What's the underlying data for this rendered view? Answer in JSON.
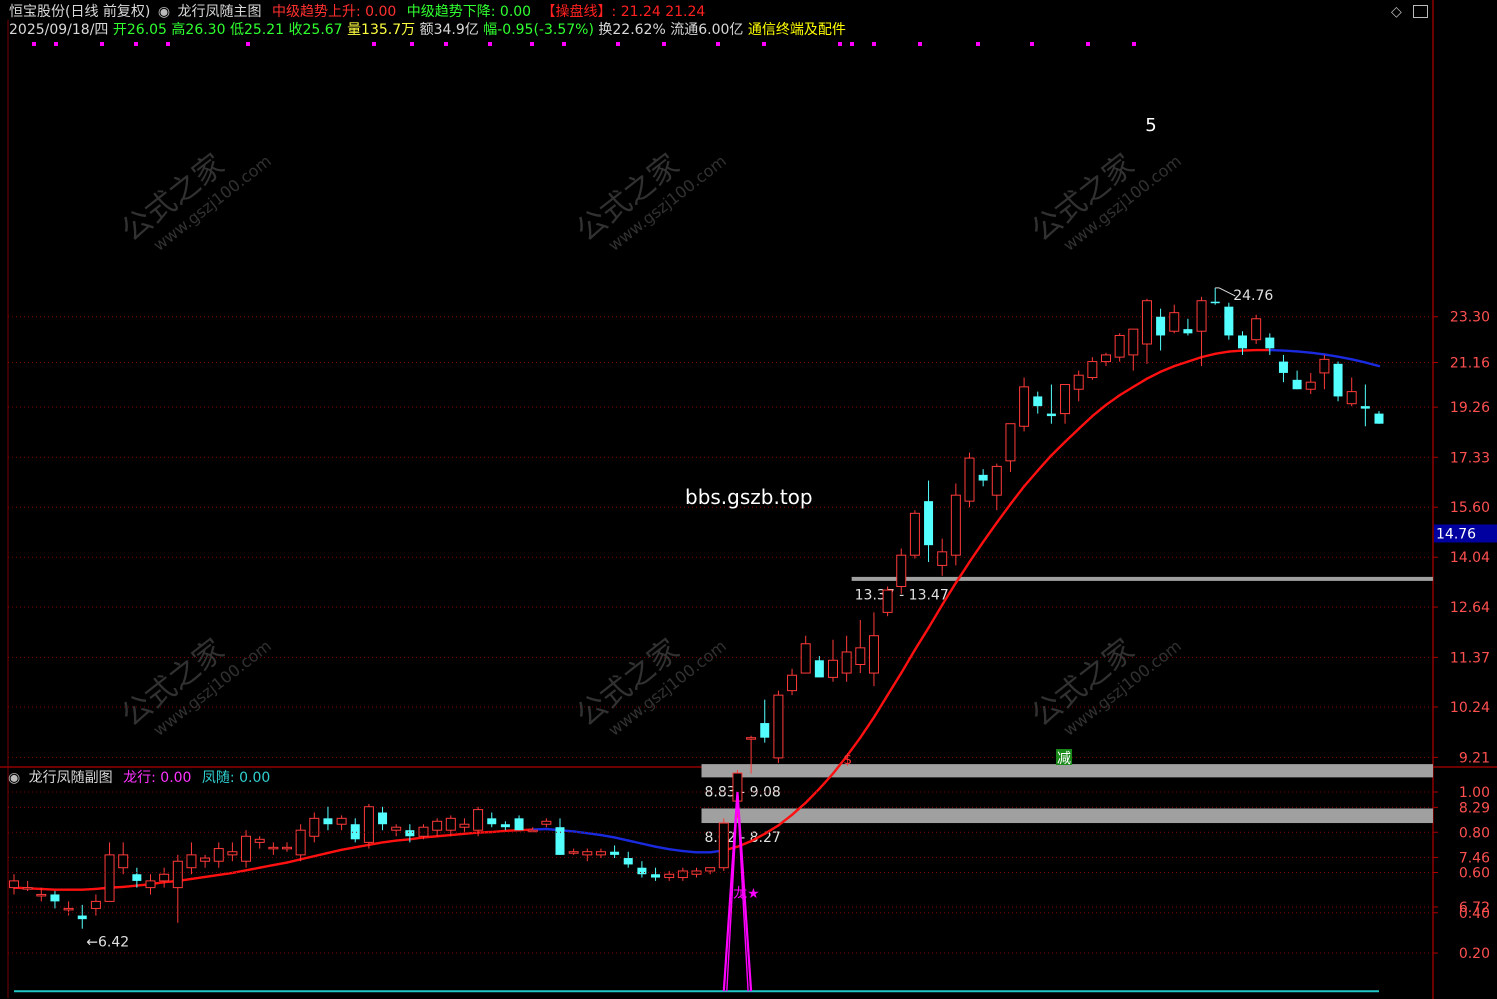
{
  "header": {
    "stock_name": "恒宝股份(日线 前复权)",
    "main_title": "龙行凤随主图",
    "mid_up": "中级趋势上升: 0.00",
    "mid_down": "中级趋势下降: 0.00",
    "control_line": "【操盘线】: 21.24 21.24"
  },
  "quote": {
    "date": "2025/09/18/四",
    "open": "开26.05",
    "high": "高26.30",
    "low": "低25.21",
    "close": "收25.67",
    "volume": "量135.7万",
    "amount": "额34.9亿",
    "change": "幅-0.95(-3.57%)",
    "turnover": "换22.62%",
    "float": "流通6.00亿",
    "link": "通信终端及配件"
  },
  "watermark": {
    "cn": "公式之家",
    "url": "www.gszj100.com",
    "site": "bbs.gszb.top"
  },
  "sub_header": {
    "title": "龙行凤随副图",
    "dragon": "龙行: 0.00",
    "phoenix": "凤随: 0.00"
  },
  "colors": {
    "up": "#ff3a3a",
    "down": "#54ffff",
    "ma_red": "#ff1010",
    "ma_blue": "#1a2adf",
    "grid": "#7a0000",
    "axis_text": "#ff5050",
    "magenta": "#ff00ff",
    "zone": "#a0a0a0"
  },
  "chart_data": [
    {
      "type": "candlestick",
      "axis_ticks": [
        "23.30",
        "21.16",
        "19.26",
        "17.33",
        "15.60",
        "14.04",
        "12.64",
        "11.37",
        "10.24",
        "9.21",
        "8.29",
        "7.46",
        "6.72"
      ],
      "ylim": [
        6.2,
        25.7
      ],
      "current_price_label": "14.76",
      "annotations": {
        "high_label": "24.76",
        "low_label": "6.42",
        "s_marker": "$",
        "jian_marker": "减",
        "digit_marker": "5"
      },
      "zones": [
        {
          "label": "13.37 - 13.47",
          "low": 13.37,
          "high": 13.47
        },
        {
          "label": "8.83 - 9.08",
          "low": 8.83,
          "high": 9.08
        },
        {
          "label": "8.02 - 8.27",
          "low": 8.02,
          "high": 8.27
        }
      ],
      "candles": [
        [
          7.0,
          7.2,
          6.9,
          7.1
        ],
        [
          7.0,
          7.1,
          6.95,
          7.0
        ],
        [
          6.9,
          7.0,
          6.8,
          6.9
        ],
        [
          6.9,
          6.95,
          6.7,
          6.8
        ],
        [
          6.7,
          6.8,
          6.6,
          6.7
        ],
        [
          6.6,
          6.75,
          6.42,
          6.55
        ],
        [
          6.7,
          6.9,
          6.6,
          6.8
        ],
        [
          6.8,
          7.7,
          6.8,
          7.5
        ],
        [
          7.3,
          7.7,
          7.2,
          7.5
        ],
        [
          7.2,
          7.3,
          7.0,
          7.1
        ],
        [
          7.0,
          7.2,
          6.9,
          7.1
        ],
        [
          7.1,
          7.3,
          7.0,
          7.2
        ],
        [
          7.0,
          7.5,
          6.5,
          7.4
        ],
        [
          7.3,
          7.7,
          7.2,
          7.5
        ],
        [
          7.4,
          7.5,
          7.3,
          7.45
        ],
        [
          7.4,
          7.7,
          7.3,
          7.6
        ],
        [
          7.5,
          7.7,
          7.4,
          7.55
        ],
        [
          7.4,
          7.9,
          7.3,
          7.8
        ],
        [
          7.7,
          7.8,
          7.6,
          7.75
        ],
        [
          7.6,
          7.7,
          7.5,
          7.62
        ],
        [
          7.6,
          7.7,
          7.55,
          7.62
        ],
        [
          7.5,
          8.0,
          7.4,
          7.9
        ],
        [
          7.8,
          8.2,
          7.7,
          8.1
        ],
        [
          8.1,
          8.3,
          7.9,
          8.0
        ],
        [
          8.0,
          8.15,
          7.9,
          8.1
        ],
        [
          8.0,
          8.1,
          7.7,
          7.75
        ],
        [
          7.7,
          8.35,
          7.6,
          8.3
        ],
        [
          8.2,
          8.3,
          7.9,
          8.0
        ],
        [
          7.9,
          8.0,
          7.8,
          7.95
        ],
        [
          7.9,
          8.0,
          7.7,
          7.8
        ],
        [
          7.8,
          8.0,
          7.75,
          7.95
        ],
        [
          7.9,
          8.1,
          7.8,
          8.05
        ],
        [
          7.9,
          8.15,
          7.8,
          8.1
        ],
        [
          7.95,
          8.1,
          7.85,
          8.0
        ],
        [
          7.9,
          8.3,
          7.8,
          8.25
        ],
        [
          8.1,
          8.2,
          7.95,
          8.0
        ],
        [
          8.0,
          8.05,
          7.9,
          7.95
        ],
        [
          8.1,
          8.15,
          7.9,
          7.9
        ],
        [
          7.9,
          7.95,
          7.9,
          7.9
        ],
        [
          8.0,
          8.1,
          7.95,
          8.05
        ],
        [
          7.95,
          8.1,
          7.5,
          7.5
        ],
        [
          7.55,
          7.6,
          7.5,
          7.55
        ],
        [
          7.5,
          7.6,
          7.4,
          7.55
        ],
        [
          7.5,
          7.6,
          7.45,
          7.55
        ],
        [
          7.55,
          7.65,
          7.45,
          7.5
        ],
        [
          7.45,
          7.55,
          7.3,
          7.35
        ],
        [
          7.3,
          7.4,
          7.15,
          7.2
        ],
        [
          7.2,
          7.3,
          7.1,
          7.15
        ],
        [
          7.15,
          7.25,
          7.1,
          7.2
        ],
        [
          7.15,
          7.3,
          7.1,
          7.25
        ],
        [
          7.2,
          7.3,
          7.15,
          7.25
        ],
        [
          7.25,
          7.3,
          7.2,
          7.3
        ],
        [
          7.3,
          8.1,
          7.25,
          8.02
        ],
        [
          8.4,
          8.97,
          8.1,
          8.91
        ],
        [
          9.6,
          9.64,
          8.9,
          9.6
        ],
        [
          9.9,
          10.4,
          9.5,
          9.6
        ],
        [
          9.2,
          10.6,
          9.1,
          10.5
        ],
        [
          10.6,
          11.1,
          10.5,
          10.95
        ],
        [
          11.0,
          11.9,
          11.0,
          11.7
        ],
        [
          11.3,
          11.4,
          10.9,
          10.9
        ],
        [
          10.9,
          11.8,
          10.8,
          11.3
        ],
        [
          11.0,
          11.9,
          10.8,
          11.5
        ],
        [
          11.2,
          12.3,
          11.0,
          11.6
        ],
        [
          11.0,
          12.5,
          10.7,
          11.9
        ],
        [
          12.5,
          13.2,
          12.4,
          13.1
        ],
        [
          13.2,
          14.3,
          13.0,
          14.1
        ],
        [
          14.1,
          15.5,
          14.0,
          15.4
        ],
        [
          15.8,
          16.5,
          13.9,
          14.4
        ],
        [
          13.8,
          14.6,
          13.5,
          14.2
        ],
        [
          14.1,
          16.4,
          13.8,
          16.0
        ],
        [
          15.8,
          17.5,
          15.6,
          17.3
        ],
        [
          16.7,
          16.9,
          16.3,
          16.5
        ],
        [
          16.0,
          17.1,
          15.5,
          17.0
        ],
        [
          17.2,
          18.6,
          16.8,
          18.6
        ],
        [
          18.5,
          20.5,
          18.3,
          20.1
        ],
        [
          19.7,
          19.9,
          19.0,
          19.3
        ],
        [
          19.0,
          20.2,
          18.6,
          18.9
        ],
        [
          19.0,
          20.2,
          18.6,
          20.2
        ],
        [
          20.0,
          20.8,
          19.5,
          20.6
        ],
        [
          20.5,
          21.4,
          20.4,
          21.2
        ],
        [
          21.2,
          21.6,
          21.0,
          21.5
        ],
        [
          21.4,
          22.5,
          21.2,
          22.4
        ],
        [
          21.5,
          22.7,
          20.8,
          22.7
        ],
        [
          22.0,
          24.2,
          21.1,
          24.1
        ],
        [
          23.3,
          23.7,
          21.7,
          22.4
        ],
        [
          22.6,
          23.9,
          22.5,
          23.5
        ],
        [
          22.7,
          23.2,
          22.4,
          22.5
        ],
        [
          22.6,
          24.3,
          21.0,
          24.1
        ],
        [
          24.05,
          24.76,
          23.9,
          24.0
        ],
        [
          23.8,
          24.0,
          22.2,
          22.4
        ],
        [
          22.4,
          22.6,
          21.5,
          21.8
        ],
        [
          22.2,
          23.4,
          22.0,
          23.2
        ],
        [
          22.3,
          22.5,
          21.5,
          21.8
        ],
        [
          21.2,
          21.5,
          20.3,
          20.7
        ],
        [
          20.4,
          20.8,
          20.0,
          20.0
        ],
        [
          20.0,
          20.7,
          19.8,
          20.3
        ],
        [
          20.7,
          21.5,
          20.0,
          21.3
        ],
        [
          21.1,
          21.2,
          19.5,
          19.7
        ],
        [
          19.4,
          20.5,
          19.3,
          19.9
        ],
        [
          19.3,
          20.2,
          18.5,
          19.2
        ],
        [
          19.0,
          19.1,
          18.6,
          18.6
        ]
      ],
      "ma_values": [
        7.0,
        6.99,
        6.98,
        6.97,
        6.97,
        6.97,
        6.98,
        7.0,
        7.01,
        7.03,
        7.05,
        7.08,
        7.1,
        7.13,
        7.16,
        7.19,
        7.22,
        7.26,
        7.3,
        7.34,
        7.38,
        7.43,
        7.48,
        7.53,
        7.58,
        7.62,
        7.66,
        7.7,
        7.73,
        7.75,
        7.78,
        7.8,
        7.82,
        7.84,
        7.86,
        7.87,
        7.89,
        7.9,
        7.91,
        7.92,
        7.9,
        7.88,
        7.85,
        7.82,
        7.78,
        7.73,
        7.68,
        7.63,
        7.59,
        7.56,
        7.54,
        7.54,
        7.57,
        7.63,
        7.72,
        7.84,
        7.98,
        8.16,
        8.37,
        8.62,
        8.9,
        9.23,
        9.6,
        10.02,
        10.5,
        11.0,
        11.55,
        12.1,
        12.7,
        13.3,
        13.9,
        14.5,
        15.1,
        15.7,
        16.3,
        16.85,
        17.4,
        17.9,
        18.4,
        18.9,
        19.35,
        19.75,
        20.1,
        20.45,
        20.75,
        21.0,
        21.2,
        21.4,
        21.55,
        21.65,
        21.7,
        21.72,
        21.72,
        21.7,
        21.66,
        21.6,
        21.52,
        21.42,
        21.3,
        21.16,
        21.0
      ],
      "ma_blue_ranges": [
        [
          38,
          52
        ],
        [
          92,
          100
        ]
      ]
    },
    {
      "type": "line",
      "axis_ticks": [
        "1.00",
        "0.80",
        "0.60",
        "0.40",
        "0.20"
      ],
      "ylim": [
        0,
        1.0
      ],
      "series": [
        {
          "name": "龙行",
          "values": [
            0,
            0,
            0,
            0,
            0,
            0,
            0,
            0,
            0,
            0,
            0,
            0,
            0,
            0,
            0,
            0,
            0,
            0,
            0,
            0,
            0,
            0,
            0,
            0,
            0,
            0,
            0,
            0,
            0,
            0,
            0,
            0,
            0,
            0,
            0,
            0,
            0,
            0,
            0,
            0,
            0,
            0,
            0,
            0,
            0,
            0,
            0,
            0,
            0,
            0,
            0,
            0,
            0,
            1,
            0,
            0,
            0,
            0,
            0,
            0,
            0,
            0,
            0,
            0,
            0,
            0,
            0,
            0,
            0,
            0,
            0,
            0,
            0,
            0,
            0,
            0,
            0,
            0,
            0,
            0,
            0,
            0,
            0,
            0,
            0,
            0,
            0,
            0,
            0,
            0,
            0,
            0,
            0,
            0,
            0,
            0,
            0,
            0,
            0,
            0,
            0
          ]
        },
        {
          "name": "凤随",
          "values": [
            0,
            0,
            0,
            0,
            0,
            0,
            0,
            0,
            0,
            0,
            0,
            0,
            0,
            0,
            0,
            0,
            0,
            0,
            0,
            0,
            0,
            0,
            0,
            0,
            0,
            0,
            0,
            0,
            0,
            0,
            0,
            0,
            0,
            0,
            0,
            0,
            0,
            0,
            0,
            0,
            0,
            0,
            0,
            0,
            0,
            0,
            0,
            0,
            0,
            0,
            0,
            0,
            0,
            0,
            0,
            0,
            0,
            0,
            0,
            0,
            0,
            0,
            0,
            0,
            0,
            0,
            0,
            0,
            0,
            0,
            0,
            0,
            0,
            0,
            0,
            0,
            0,
            0,
            0,
            0,
            0,
            0,
            0,
            0,
            0,
            0,
            0,
            0,
            0,
            0,
            0,
            0,
            0,
            0,
            0,
            0,
            0,
            0,
            0,
            0,
            0
          ]
        }
      ],
      "annotations": {
        "dragon_marker": "龙★"
      }
    }
  ]
}
